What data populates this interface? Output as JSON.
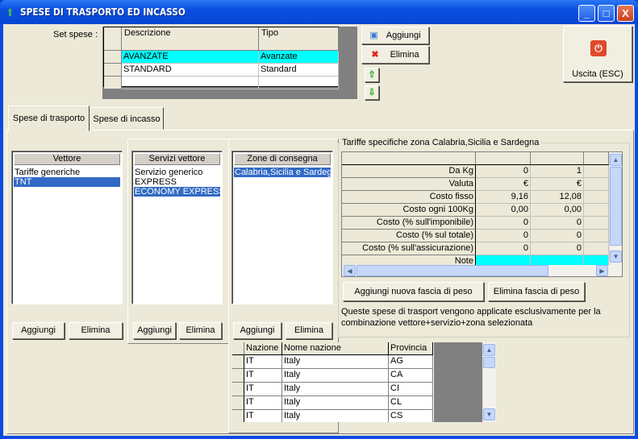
{
  "window": {
    "title": "SPESE DI TRASPORTO ED INCASSO",
    "minimize": "_",
    "maximize": "□",
    "close": "X"
  },
  "set_spese": {
    "label": "Set spese :",
    "columns": [
      "Descrizione",
      "Tipo"
    ],
    "rows": [
      {
        "descrizione": "AVANZATE",
        "tipo": "Avanzate",
        "selected": true
      },
      {
        "descrizione": "STANDARD",
        "tipo": "Standard"
      }
    ],
    "add_label": "Aggiungi",
    "delete_label": "Elimina",
    "up_icon": "arrow-up-icon",
    "down_icon": "arrow-down-icon"
  },
  "exit_button": {
    "label": "Uscita (ESC)",
    "icon": "power-icon"
  },
  "tabs": [
    {
      "label": "Spese di trasporto",
      "active": true
    },
    {
      "label": "Spese di incasso"
    }
  ],
  "vettore": {
    "header": "Vettore",
    "items": [
      "Tariffe generiche",
      "TNT"
    ],
    "selected": 1,
    "add": "Aggiungi",
    "delete": "Elimina"
  },
  "servizi": {
    "header": "Servizi vettore",
    "items": [
      "Servizio generico",
      "EXPRESS",
      "ECONOMY EXPRESS"
    ],
    "selected": 2,
    "add": "Aggiungi",
    "delete": "Elimina"
  },
  "zone": {
    "header": "Zone di consegna",
    "items": [
      "Calabria,Sicilia e Sardegna"
    ],
    "selected": 0,
    "add": "Aggiungi",
    "delete": "Elimina"
  },
  "tariffe": {
    "title": "Tariffe specifiche zona Calabria,Sicilia e Sardegna",
    "rows": [
      {
        "label": "Da Kg",
        "values": [
          "0",
          "1"
        ]
      },
      {
        "label": "Valuta",
        "values": [
          "€",
          "€"
        ]
      },
      {
        "label": "Costo fisso",
        "values": [
          "9,16",
          "12,08"
        ]
      },
      {
        "label": "Costo ogni 100Kg",
        "values": [
          "0,00",
          "0,00"
        ]
      },
      {
        "label": "Costo (% sull'imponibile)",
        "values": [
          "0",
          "0"
        ]
      },
      {
        "label": "Costo (% sul totale)",
        "values": [
          "0",
          "0"
        ]
      },
      {
        "label": "Costo (% sull'assicurazione)",
        "values": [
          "0",
          "0"
        ]
      },
      {
        "label": "Note",
        "values": [
          "",
          ""
        ]
      }
    ],
    "add_band": "Aggiungi nuova fascia di peso",
    "delete_band": "Elimina fascia di peso",
    "note": "Queste spese di trasport vengono applicate esclusivamente per la combinazione vettore+servizio+zona selezionata"
  },
  "nazioni": {
    "columns": [
      "Nazione",
      "Nome nazione",
      "Provincia"
    ],
    "rows": [
      [
        "IT",
        "Italy",
        "AG"
      ],
      [
        "IT",
        "Italy",
        "CA"
      ],
      [
        "IT",
        "Italy",
        "CI"
      ],
      [
        "IT",
        "Italy",
        "CL"
      ],
      [
        "IT",
        "Italy",
        "CS"
      ]
    ]
  },
  "colors": {
    "title_bar": "#0a4fe0",
    "selection": "#316ac5",
    "highlight_row": "#00ffff",
    "face": "#ece9d8"
  }
}
